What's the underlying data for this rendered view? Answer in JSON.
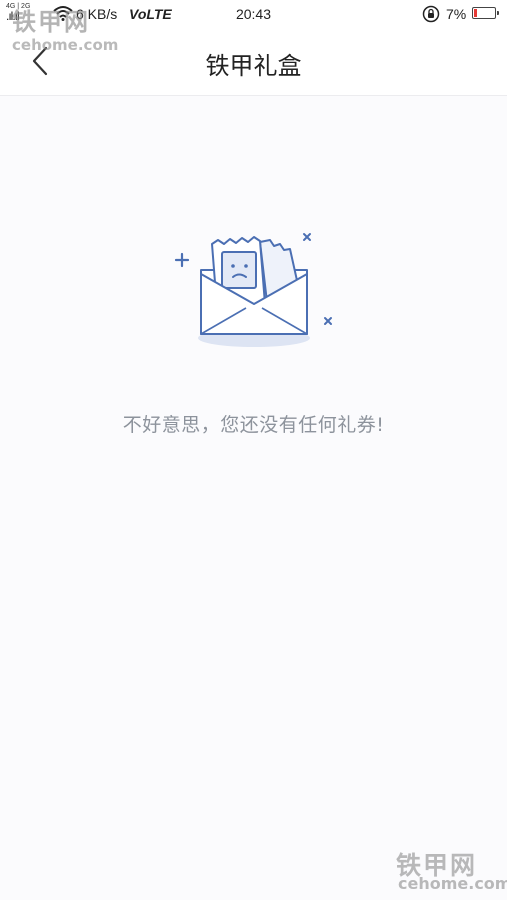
{
  "status_bar": {
    "signal_meta": "4G  | 2G",
    "signal_bars": ".ıl.ıl",
    "network_speed": "6 KB/s",
    "volte": "VoLTE",
    "time": "20:43",
    "battery_percent": "7%",
    "battery_level": 0.07,
    "battery_color": "#e53935",
    "icons": [
      "wifi-icon",
      "rotation-lock-icon",
      "battery-icon"
    ]
  },
  "watermark": {
    "logo": "铁甲网",
    "url": "cehome.com"
  },
  "nav": {
    "back_icon": "chevron-left-icon",
    "title": "铁甲礼盒"
  },
  "empty_state": {
    "illustration": "envelope-sad-tickets-icon",
    "message": "不好意思，您还没有任何礼券!"
  },
  "colors": {
    "accent": "#4b6fb3",
    "illustration_fill": "#dde4f3",
    "message_text": "#8d939c"
  }
}
